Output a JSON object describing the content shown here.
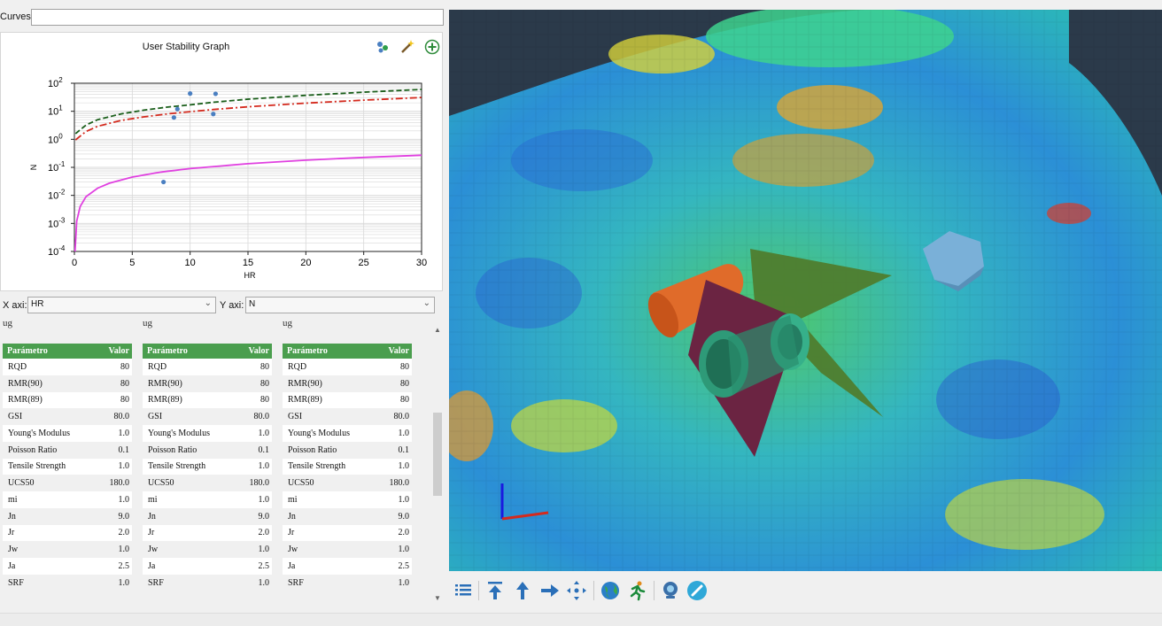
{
  "curves": {
    "label": "Curves",
    "value": ""
  },
  "graph": {
    "title": "User Stability Graph",
    "toolbar_icons": [
      "scatter-settings-icon",
      "magic-wand-icon",
      "add-circle-icon"
    ]
  },
  "axis_select": {
    "x_label": "X axi:",
    "x_value": "HR",
    "y_label": "Y axi:",
    "y_value": "N"
  },
  "chart_data": {
    "type": "line",
    "title": "User Stability Graph",
    "xlabel": "HR",
    "ylabel": "N",
    "xlim": [
      0,
      30
    ],
    "ylim": [
      0.0001,
      100
    ],
    "y_scale": "log",
    "grid": true,
    "x_ticks": [
      "0",
      "5",
      "10",
      "15",
      "20",
      "25",
      "30"
    ],
    "y_ticks": [
      {
        "base": "10",
        "exp": "2"
      },
      {
        "base": "10",
        "exp": "1"
      },
      {
        "base": "10",
        "exp": "0"
      },
      {
        "base": "10",
        "exp": "-1"
      },
      {
        "base": "10",
        "exp": "-2"
      },
      {
        "base": "10",
        "exp": "-3"
      },
      {
        "base": "10",
        "exp": "-4"
      }
    ],
    "series": [
      {
        "style": "dashed",
        "color": "#1a5e1a",
        "x": [
          0.1,
          1,
          2,
          4,
          6,
          8,
          10,
          12,
          15,
          20,
          25,
          30
        ],
        "y": [
          1.6,
          3.2,
          5.0,
          8.0,
          11,
          14,
          17,
          21,
          27,
          37,
          48,
          60
        ]
      },
      {
        "style": "dashdot",
        "color": "#d42a1e",
        "x": [
          0.1,
          1,
          2,
          4,
          6,
          8,
          10,
          12,
          15,
          20,
          25,
          30
        ],
        "y": [
          0.95,
          1.9,
          2.9,
          4.7,
          6.3,
          8.0,
          9.7,
          11.5,
          14.5,
          19.5,
          25,
          31
        ]
      },
      {
        "style": "solid",
        "color": "#e040e0",
        "x": [
          0.05,
          0.2,
          0.5,
          1,
          2,
          3,
          5,
          7.5,
          10,
          15,
          20,
          25,
          30
        ],
        "y": [
          0.0001,
          0.0012,
          0.004,
          0.009,
          0.018,
          0.027,
          0.045,
          0.068,
          0.09,
          0.135,
          0.18,
          0.225,
          0.27
        ]
      },
      {
        "style": "points",
        "color": "#4a7fc1",
        "x": [
          7.7,
          8.6,
          8.9,
          10.0,
          12.0,
          12.2
        ],
        "y": [
          0.03,
          6.0,
          12.0,
          43.0,
          8.0,
          42.0
        ]
      }
    ]
  },
  "tables": [
    {
      "caption": "ug",
      "header": [
        "Parámetro",
        "Valor"
      ],
      "rows": [
        [
          "RQD",
          "80"
        ],
        [
          "RMR(90)",
          "80"
        ],
        [
          "RMR(89)",
          "80"
        ],
        [
          "GSI",
          "80.0"
        ],
        [
          "Young's Modulus",
          "1.0"
        ],
        [
          "Poisson Ratio",
          "0.1"
        ],
        [
          "Tensile Strength",
          "1.0"
        ],
        [
          "UCS50",
          "180.0"
        ],
        [
          "mi",
          "1.0"
        ],
        [
          "Jn",
          "9.0"
        ],
        [
          "Jr",
          "2.0"
        ],
        [
          "Jw",
          "1.0"
        ],
        [
          "Ja",
          "2.5"
        ],
        [
          "SRF",
          "1.0"
        ]
      ]
    },
    {
      "caption": "ug",
      "header": [
        "Parámetro",
        "Valor"
      ],
      "rows": [
        [
          "RQD",
          "80"
        ],
        [
          "RMR(90)",
          "80"
        ],
        [
          "RMR(89)",
          "80"
        ],
        [
          "GSI",
          "80.0"
        ],
        [
          "Young's Modulus",
          "1.0"
        ],
        [
          "Poisson Ratio",
          "0.1"
        ],
        [
          "Tensile Strength",
          "1.0"
        ],
        [
          "UCS50",
          "180.0"
        ],
        [
          "mi",
          "1.0"
        ],
        [
          "Jn",
          "9.0"
        ],
        [
          "Jr",
          "2.0"
        ],
        [
          "Jw",
          "1.0"
        ],
        [
          "Ja",
          "2.5"
        ],
        [
          "SRF",
          "1.0"
        ]
      ]
    },
    {
      "caption": "ug",
      "header": [
        "Parámetro",
        "Valor"
      ],
      "rows": [
        [
          "RQD",
          "80"
        ],
        [
          "RMR(90)",
          "80"
        ],
        [
          "RMR(89)",
          "80"
        ],
        [
          "GSI",
          "80.0"
        ],
        [
          "Young's Modulus",
          "1.0"
        ],
        [
          "Poisson Ratio",
          "0.1"
        ],
        [
          "Tensile Strength",
          "1.0"
        ],
        [
          "UCS50",
          "180.0"
        ],
        [
          "mi",
          "1.0"
        ],
        [
          "Jn",
          "9.0"
        ],
        [
          "Jr",
          "2.0"
        ],
        [
          "Jw",
          "1.0"
        ],
        [
          "Ja",
          "2.5"
        ],
        [
          "SRF",
          "1.0"
        ]
      ]
    }
  ],
  "viewport": {
    "background": "#2b3a4a",
    "colormap": [
      "#1f3ec8",
      "#2a8ad8",
      "#2fbfd0",
      "#3ad08a",
      "#66d64a",
      "#c8d83a",
      "#e89a2a",
      "#d83a2a"
    ],
    "objects": [
      "terrain-surface",
      "orange-cylinder",
      "maroon-plane",
      "green-plane",
      "tunnel-mesh",
      "blue-rock-mesh",
      "axis-gizmo"
    ]
  },
  "toolbar": {
    "buttons": [
      "list-icon",
      "align-top-icon",
      "arrow-up-icon",
      "arrow-right-icon",
      "center-view-icon",
      "globe-icon",
      "runner-icon",
      "webcam-icon",
      "paint-brush-icon"
    ]
  }
}
